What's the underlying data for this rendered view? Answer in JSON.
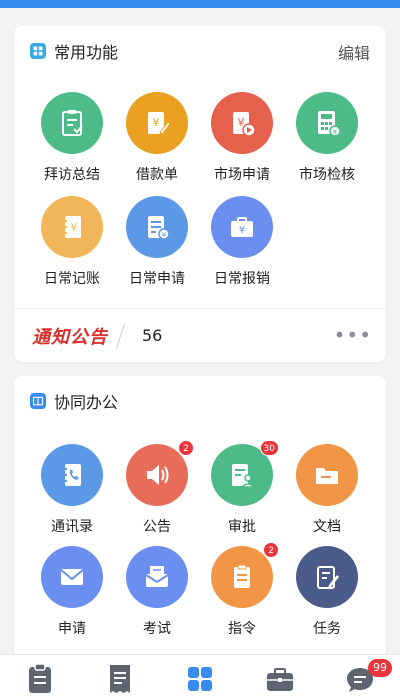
{
  "colors": {
    "accent": "#3a8bf0",
    "green": "#4dbb87",
    "orange": "#eaa020",
    "red": "#e6604c",
    "lightOrange": "#f1b55a",
    "blue": "#5b98e6",
    "periwinkle": "#6b8ff0",
    "salmon": "#e86c5a",
    "amber": "#f19646",
    "navy": "#4b5b89",
    "badge": "#e8363c"
  },
  "common": {
    "title": "常用功能",
    "edit_label": "编辑",
    "items": [
      {
        "label": "拜访总结",
        "icon": "clipboard-check-icon"
      },
      {
        "label": "借款单",
        "icon": "yuan-edit-icon"
      },
      {
        "label": "市场申请",
        "icon": "yuan-play-icon"
      },
      {
        "label": "市场检核",
        "icon": "calculator-icon"
      },
      {
        "label": "日常记账",
        "icon": "ledger-icon"
      },
      {
        "label": "日常申请",
        "icon": "document-yuan-icon"
      },
      {
        "label": "日常报销",
        "icon": "briefcase-yuan-icon"
      }
    ]
  },
  "notice": {
    "logo_text": "通知公告",
    "count": "56"
  },
  "cowork": {
    "title": "协同办公",
    "items": [
      {
        "label": "通讯录",
        "icon": "contacts-icon",
        "badge": ""
      },
      {
        "label": "公告",
        "icon": "speaker-icon",
        "badge": "2"
      },
      {
        "label": "审批",
        "icon": "approval-icon",
        "badge": "30"
      },
      {
        "label": "文档",
        "icon": "folder-icon",
        "badge": ""
      },
      {
        "label": "申请",
        "icon": "mail-icon",
        "badge": ""
      },
      {
        "label": "考试",
        "icon": "exam-mail-icon",
        "badge": ""
      },
      {
        "label": "指令",
        "icon": "clipboard-icon",
        "badge": "2"
      },
      {
        "label": "任务",
        "icon": "task-edit-icon",
        "badge": ""
      }
    ]
  },
  "tabbar": {
    "tabs": [
      {
        "icon": "clipboard-tab-icon"
      },
      {
        "icon": "receipt-tab-icon"
      },
      {
        "icon": "apps-grid-tab-icon",
        "active": true
      },
      {
        "icon": "briefcase-tab-icon"
      },
      {
        "icon": "chat-tab-icon",
        "badge": "99"
      }
    ]
  }
}
